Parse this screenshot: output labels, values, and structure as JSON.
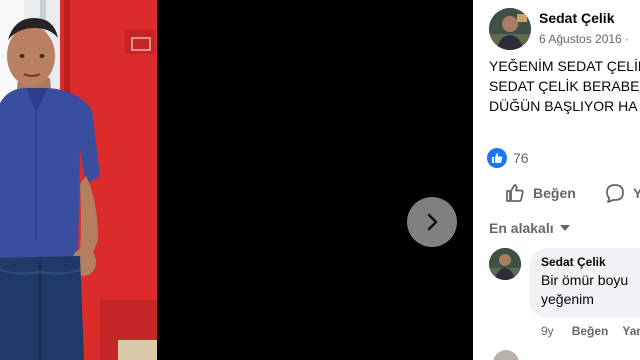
{
  "viewer": {
    "next_icon": "chevron-right-icon"
  },
  "post": {
    "author": "Sedat Çelik",
    "date": "6 Ağustos 2016",
    "date_separator": "·",
    "text_lines": [
      "YEĞENİM SEDAT ÇELİK",
      "SEDAT ÇELİK BERABER",
      "DÜĞÜN BAŞLIYOR HA"
    ],
    "reaction_icon": "like-icon",
    "reaction_count": "76"
  },
  "actions": {
    "like_label": "Beğen",
    "like_icon": "thumbs-up-icon",
    "comment_label": "Y",
    "comment_icon": "comment-bubble-icon"
  },
  "comments": {
    "sort_label": "En alakalı",
    "items": [
      {
        "author": "Sedat Çelik",
        "text_lines": [
          "Bir ömür boyu",
          "yeğenim"
        ],
        "time": "9y",
        "like_label": "Beğen",
        "reply_label": "Yan"
      }
    ]
  },
  "colors": {
    "accent": "#1877f2",
    "secondary_text": "#65676b",
    "primary_text": "#050505",
    "bubble": "#f0f2f5",
    "wall_red": "#dc2b2b"
  }
}
